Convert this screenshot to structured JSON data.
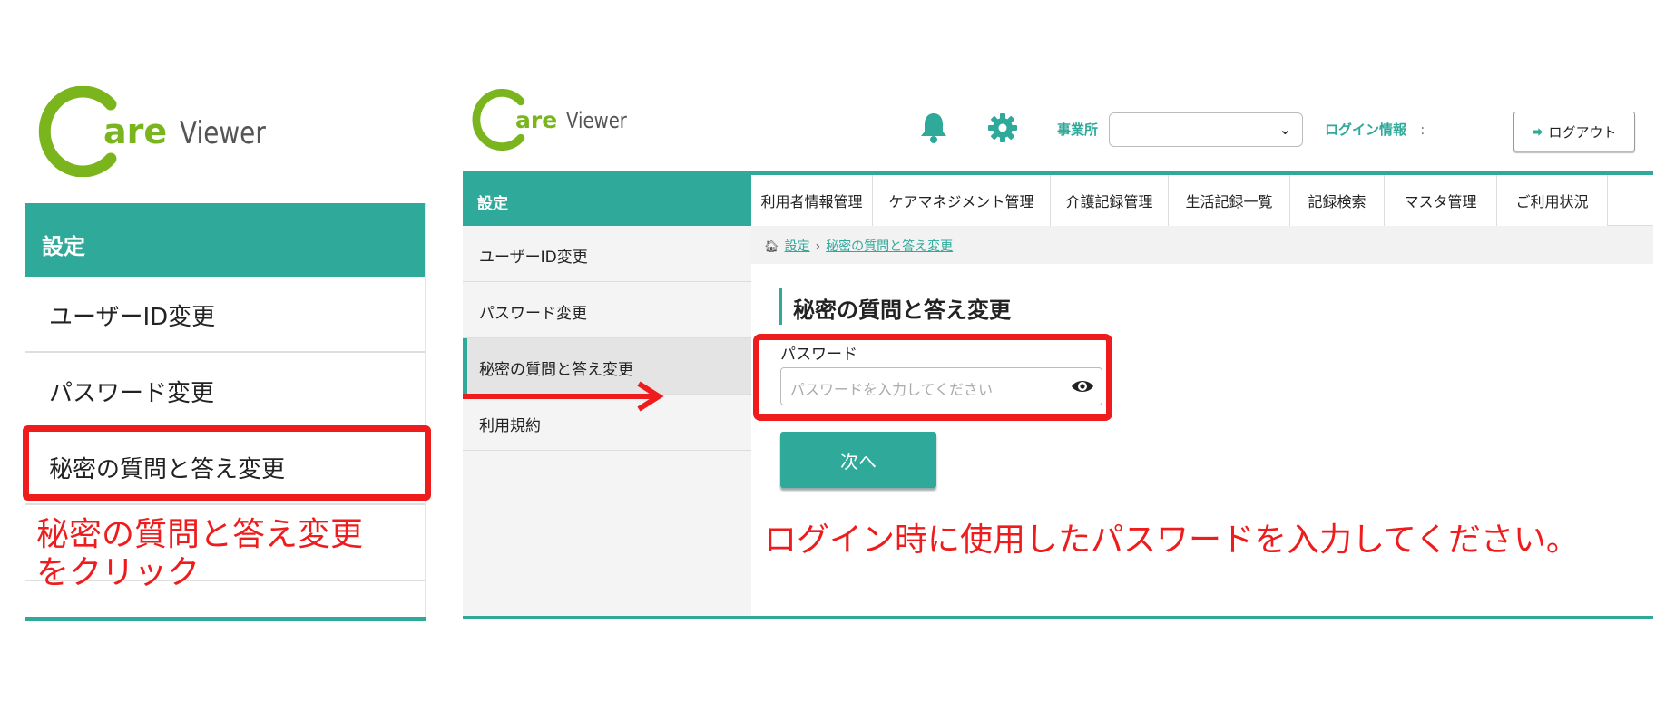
{
  "brand": {
    "c_letter": "C",
    "are": "are",
    "viewer": "Viewer",
    "green": "#7ab51d",
    "teal": "#2fa99a"
  },
  "zoom": {
    "header": "設定",
    "items": [
      {
        "label": "ユーザーID変更"
      },
      {
        "label": "パスワード変更"
      },
      {
        "label": "秘密の質問と答え変更"
      }
    ],
    "caption": [
      "秘密の質問と答え変更",
      "をクリック"
    ],
    "highlight_color": "#ee1c1c"
  },
  "app": {
    "header": {
      "office_label": "事業所",
      "office_select_value": "",
      "login_info_label": "ログイン情報",
      "login_info_colon": ":",
      "logout_label": "ログアウト"
    },
    "sidebar": {
      "title": "設定",
      "items": [
        {
          "label": "ユーザーID変更"
        },
        {
          "label": "パスワード変更"
        },
        {
          "label": "秘密の質問と答え変更",
          "active": true
        },
        {
          "label": "利用規約"
        }
      ]
    },
    "topnav": [
      {
        "label": "利用者情報管理"
      },
      {
        "label": "ケアマネジメント管理"
      },
      {
        "label": "介護記録管理"
      },
      {
        "label": "生活記録一覧"
      },
      {
        "label": "記録検索"
      },
      {
        "label": "マスタ管理"
      },
      {
        "label": "ご利用状況"
      }
    ],
    "breadcrumb": {
      "home": "設定",
      "separator": "›",
      "current": "秘密の質問と答え変更"
    },
    "page_title": "秘密の質問と答え変更",
    "form": {
      "password_label": "パスワード",
      "password_placeholder": "パスワードを入力してください",
      "password_value": "",
      "next_label": "次へ"
    },
    "caption": "ログイン時に使用したパスワードを入力してください。"
  }
}
